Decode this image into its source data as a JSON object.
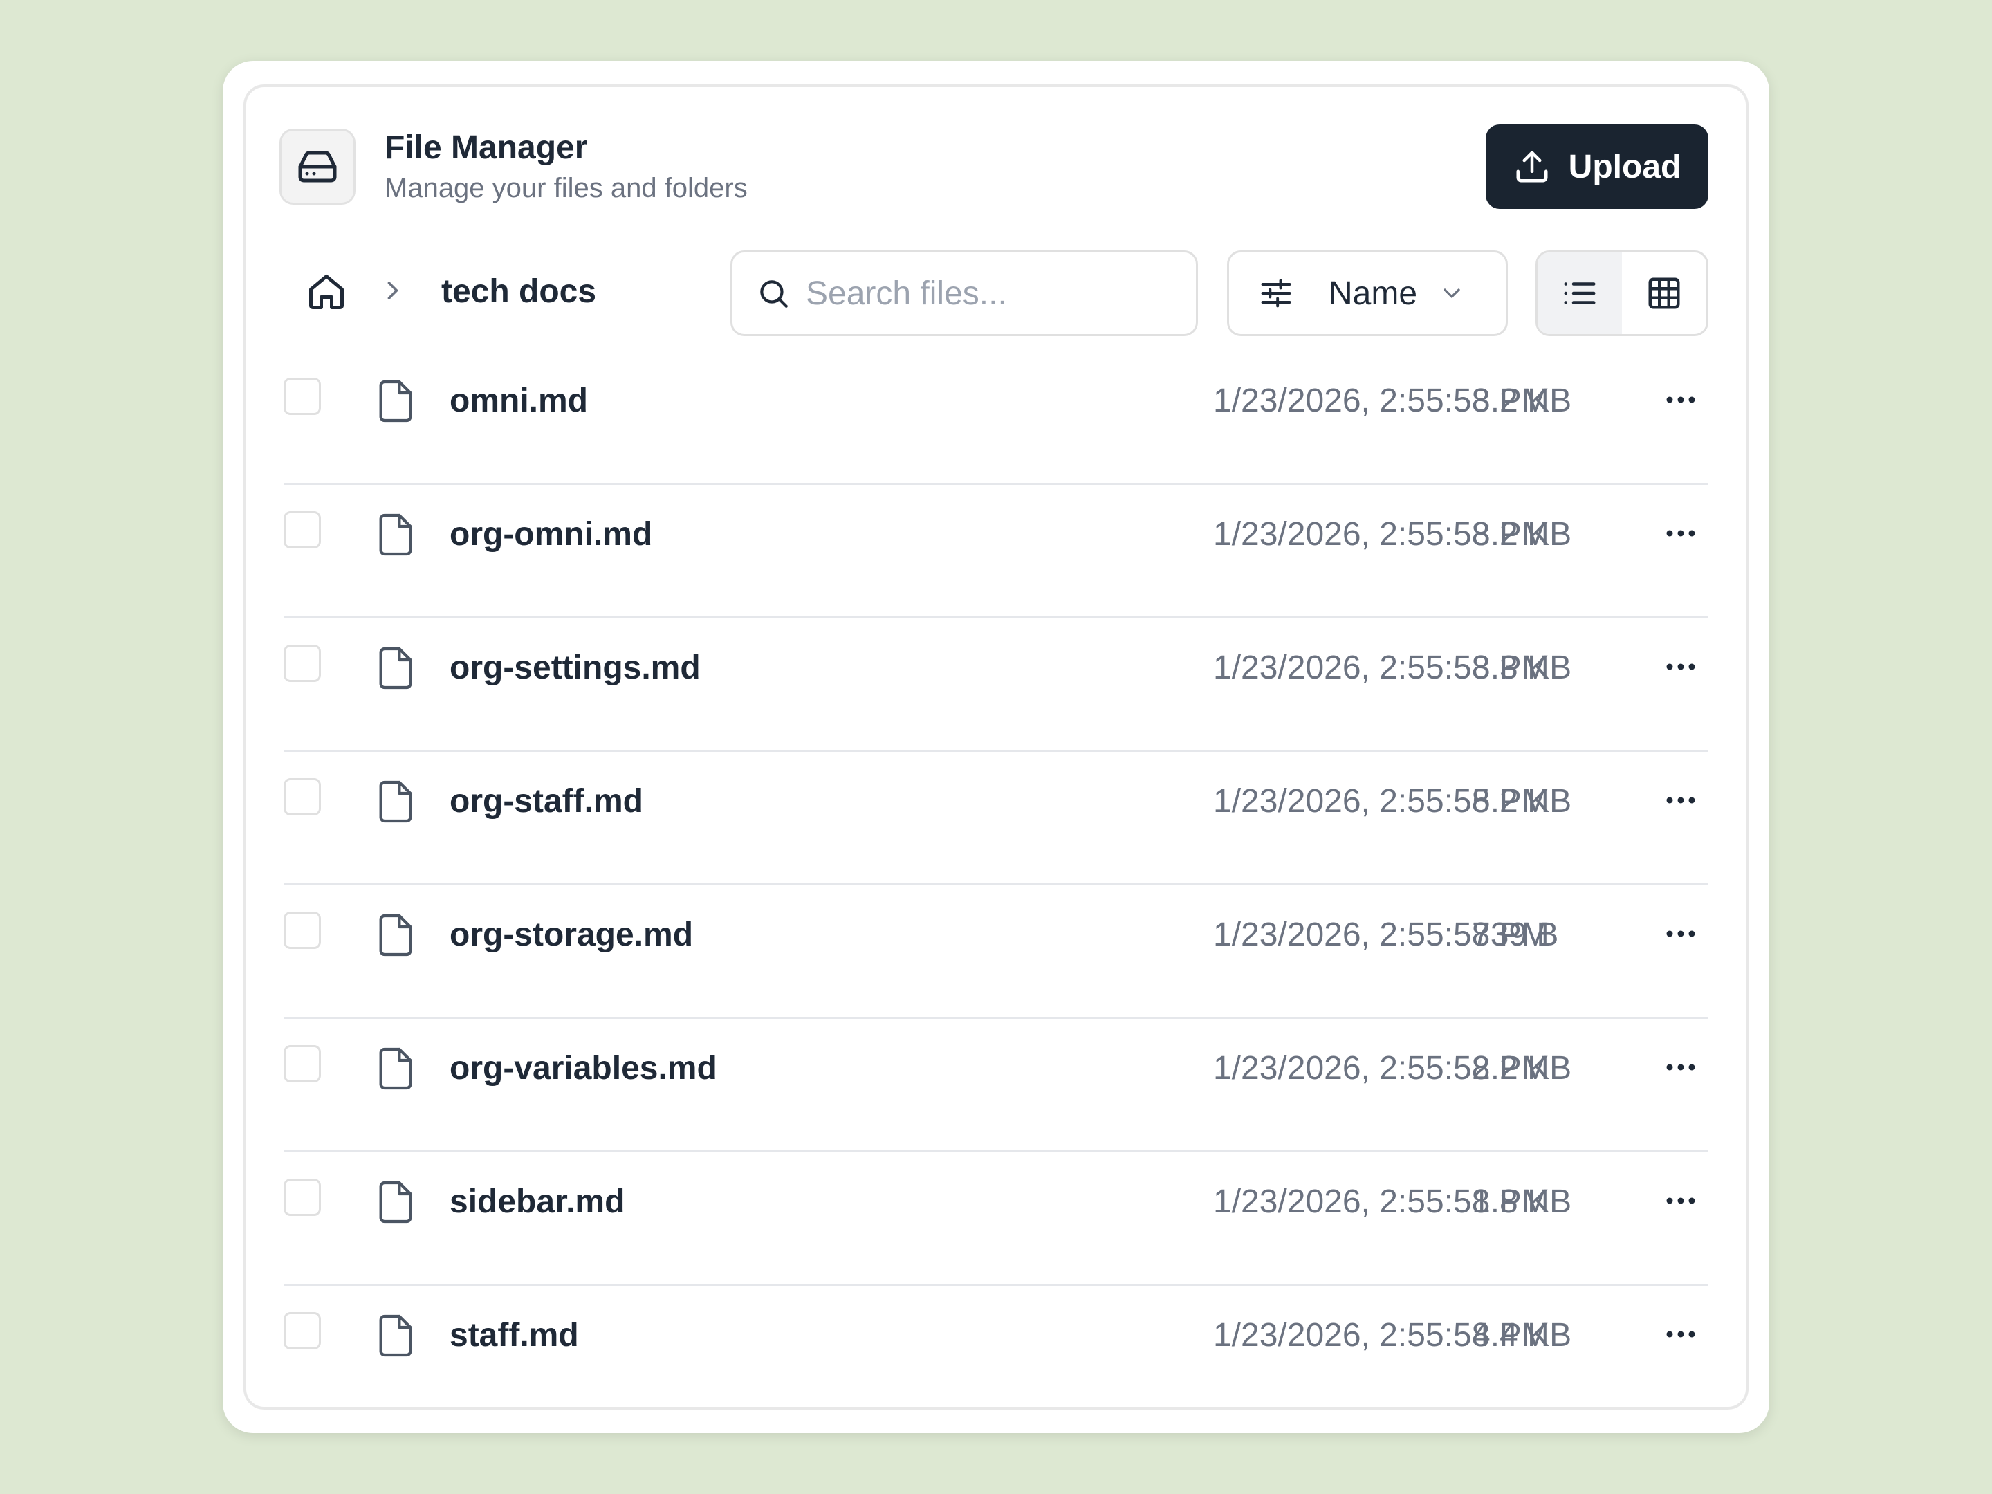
{
  "header": {
    "title": "File Manager",
    "subtitle": "Manage your files and folders",
    "upload_label": "Upload",
    "icon": "hard-drive-icon"
  },
  "breadcrumb": {
    "home_icon": "home-icon",
    "separator_icon": "chevron-right-icon",
    "current": "tech docs"
  },
  "search": {
    "placeholder": "Search files...",
    "value": ""
  },
  "sort": {
    "label": "Name",
    "icon": "sliders-icon"
  },
  "view": {
    "active": "list",
    "options": [
      "list",
      "grid"
    ]
  },
  "colors": {
    "upload_bg": "#1a2430",
    "page_bg": "#dde8d2"
  },
  "files": [
    {
      "name": "omni.md",
      "modified": "1/23/2026, 2:55:58 PM",
      "size": "3.2 KB"
    },
    {
      "name": "org-omni.md",
      "modified": "1/23/2026, 2:55:58 PM",
      "size": "3.2 KB"
    },
    {
      "name": "org-settings.md",
      "modified": "1/23/2026, 2:55:58 PM",
      "size": "3.3 KB"
    },
    {
      "name": "org-staff.md",
      "modified": "1/23/2026, 2:55:58 PM",
      "size": "5.2 KB"
    },
    {
      "name": "org-storage.md",
      "modified": "1/23/2026, 2:55:58 PM",
      "size": "739 B"
    },
    {
      "name": "org-variables.md",
      "modified": "1/23/2026, 2:55:58 PM",
      "size": "2.2 KB"
    },
    {
      "name": "sidebar.md",
      "modified": "1/23/2026, 2:55:58 PM",
      "size": "1.8 KB"
    },
    {
      "name": "staff.md",
      "modified": "1/23/2026, 2:55:58 PM",
      "size": "4.4 KB"
    }
  ]
}
